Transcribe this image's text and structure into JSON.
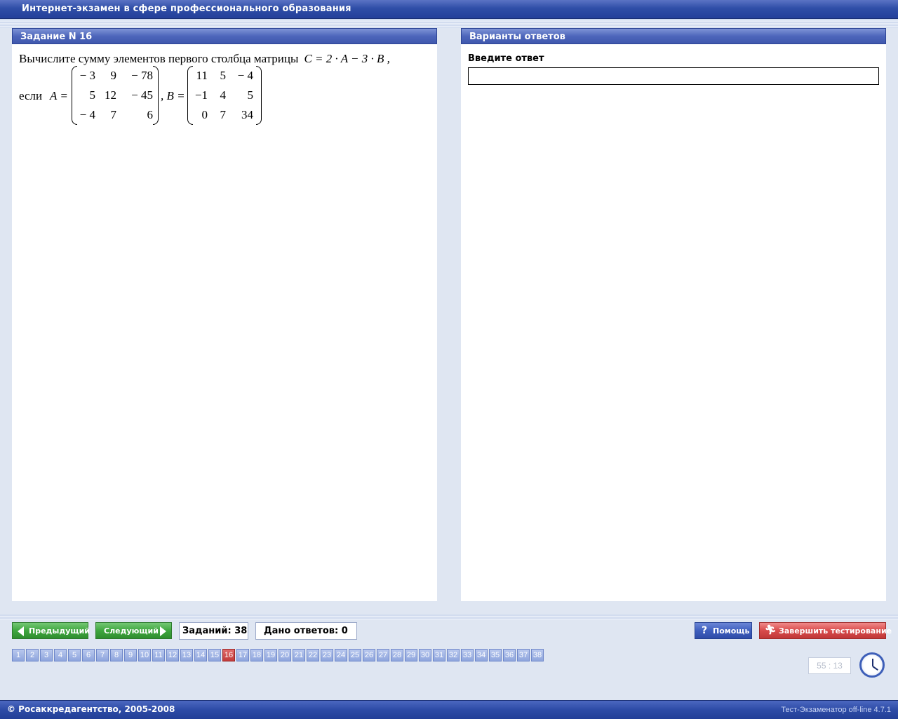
{
  "window": {
    "title": "Интернет-экзамен в сфере профессионального образования"
  },
  "task_panel": {
    "header": "Задание N 16",
    "question_text": "Вычислите сумму элементов первого столбца матрицы",
    "formula": "C = 2 · A − 3 · B ,",
    "condition_word": "если",
    "matrix_a_label": "A =",
    "matrix_b_label": ", B =",
    "matrix_a": [
      [
        "− 3",
        "9",
        "− 78"
      ],
      [
        "5",
        "12",
        "− 45"
      ],
      [
        "− 4",
        "7",
        "6"
      ]
    ],
    "matrix_b": [
      [
        "11",
        "5",
        "− 4"
      ],
      [
        "−1",
        "4",
        "5"
      ],
      [
        "0",
        "7",
        "34"
      ]
    ]
  },
  "answer_panel": {
    "header": "Варианты ответов",
    "input_label": "Введите ответ",
    "input_value": ""
  },
  "navigation": {
    "prev_label": "Предыдущий",
    "next_label": "Следующий",
    "tasks_count": "Заданий: 38",
    "answers_count": "Дано ответов: 0",
    "help_label": "Помощь",
    "finish_label": "Завершить тестирование",
    "current_task": 16,
    "task_numbers": [
      "1",
      "2",
      "3",
      "4",
      "5",
      "6",
      "7",
      "8",
      "9",
      "10",
      "11",
      "12",
      "13",
      "14",
      "15",
      "16",
      "17",
      "18",
      "19",
      "20",
      "21",
      "22",
      "23",
      "24",
      "25",
      "26",
      "27",
      "28",
      "29",
      "30",
      "31",
      "32",
      "33",
      "34",
      "35",
      "36",
      "37",
      "38"
    ]
  },
  "timer": {
    "value": "55 : 13"
  },
  "footer": {
    "copyright": "© Росаккредагентство, 2005-2008",
    "version": "Тест-Экзаменатор off-line 4.7.1"
  },
  "colors": {
    "accent_blue": "#2f4ea7",
    "active_task": "#c23a3a",
    "green_button": "#3fa63f",
    "red_button": "#d84b4b"
  }
}
